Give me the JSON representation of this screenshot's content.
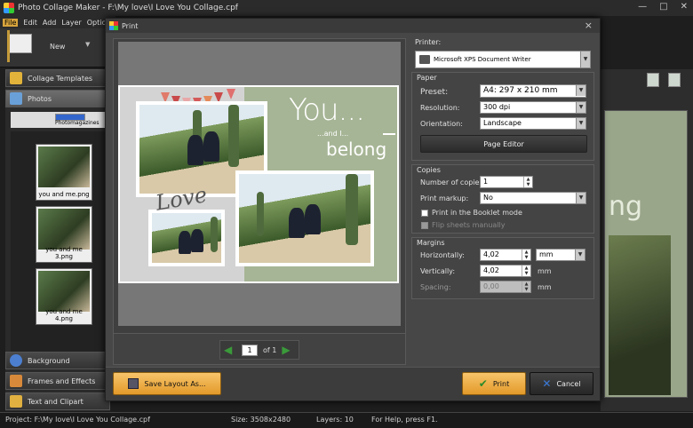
{
  "app": {
    "title": "Photo Collage Maker - F:\\My love\\I Love You Collage.cpf",
    "menu": [
      "File",
      "Edit",
      "Add",
      "Layer",
      "Optic"
    ],
    "toolbar": {
      "new_label": "New"
    },
    "left_panel": {
      "sections": [
        "Collage Templates",
        "Photos",
        "Background",
        "Frames and Effects",
        "Text and Clipart"
      ],
      "tree_item": "Photomagazines",
      "thumbnails": [
        "you and me.png",
        "you and me 3.png",
        "you and me 4.png"
      ]
    },
    "status": {
      "project": "Project: F:\\My love\\I Love You Collage.cpf",
      "size": "Size: 3508x2480",
      "layers": "Layers: 10",
      "help": "For Help, press F1."
    },
    "right_preview_text": "ng"
  },
  "dialog": {
    "title": "Print",
    "close": "×",
    "collage": {
      "you": "You...",
      "andi": "...and I...",
      "belong": "belong",
      "love": "Love"
    },
    "pager": {
      "page": "1",
      "of": "of 1"
    },
    "printer_label": "Printer:",
    "printer": "Microsoft XPS Document Writer",
    "paper": {
      "label": "Paper",
      "preset_label": "Preset:",
      "preset": "A4: 297 x 210 mm",
      "resolution_label": "Resolution:",
      "resolution": "300 dpi",
      "orientation_label": "Orientation:",
      "orientation": "Landscape",
      "page_editor": "Page Editor"
    },
    "copies": {
      "label": "Copies",
      "number_label": "Number of copies:",
      "number": "1",
      "markup_label": "Print markup:",
      "markup": "No",
      "booklet": "Print in the Booklet mode",
      "flip": "Flip sheets manually"
    },
    "margins": {
      "label": "Margins",
      "horizontal_label": "Horizontally:",
      "horizontal": "4,02",
      "horizontal_unit": "mm",
      "vertical_label": "Vertically:",
      "vertical": "4,02",
      "vertical_unit": "mm",
      "spacing_label": "Spacing:",
      "spacing": "0,00",
      "spacing_unit": "mm"
    },
    "buttons": {
      "save_layout": "Save Layout As...",
      "print": "Print",
      "cancel": "Cancel"
    }
  }
}
